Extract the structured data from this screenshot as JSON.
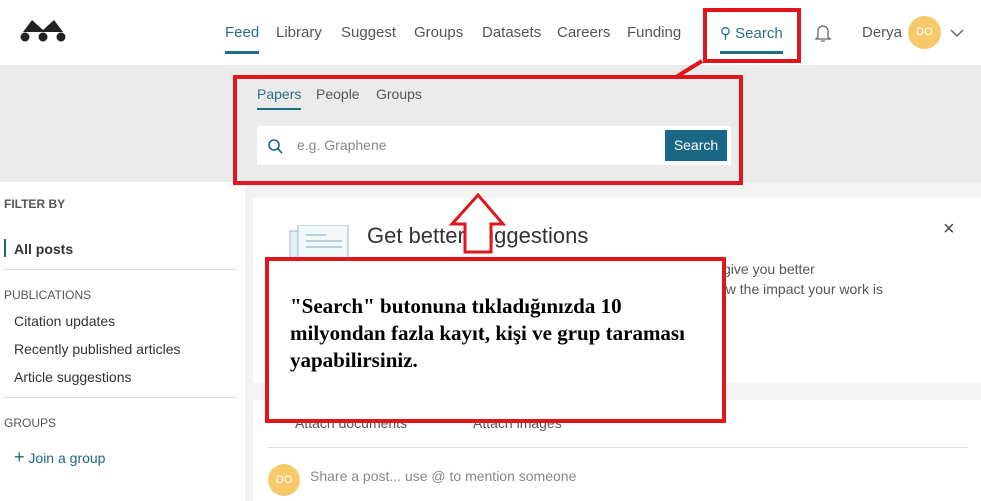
{
  "header": {
    "nav": [
      "Feed",
      "Library",
      "Suggest",
      "Groups",
      "Datasets",
      "Careers",
      "Funding"
    ],
    "active": "Feed",
    "search_label": "Search",
    "user_name": "Derya",
    "avatar_initials": "DO"
  },
  "search": {
    "tabs": [
      "Papers",
      "People",
      "Groups"
    ],
    "active": "Papers",
    "placeholder": "e.g. Graphene",
    "button": "Search"
  },
  "sidebar": {
    "filter_by": "FILTER BY",
    "all_posts": "All posts",
    "publications_heading": "PUBLICATIONS",
    "publications": [
      "Citation updates",
      "Recently published articles",
      "Article suggestions"
    ],
    "groups_heading": "GROUPS",
    "join_group": "Join a group"
  },
  "suggestion_card": {
    "title": "Get better suggestions",
    "line1_fragment": "give you better",
    "line2_fragment": "ow the impact your work is",
    "close": "×"
  },
  "post_card": {
    "attach_documents": "Attach documents",
    "attach_images": "Attach images",
    "placeholder": "Share a post... use @ to mention someone",
    "avatar_initials": "DO"
  },
  "annotation": {
    "text": "\"Search\" butonuna tıkladığınızda 10 milyondan fazla kayıt, kişi ve grup taraması yapabilirsiniz.",
    "color": "#e0161f"
  },
  "colors": {
    "accent": "#1a6785",
    "avatar": "#f6c96b"
  }
}
